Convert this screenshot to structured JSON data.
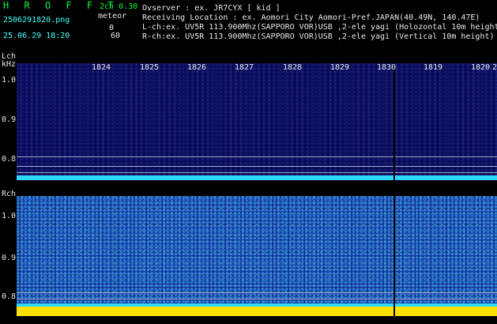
{
  "header": {
    "title": "H R O F F T",
    "channels": "2ch 0.30",
    "filename": "2506291820.png",
    "meteor_label": "meteor",
    "datetime": "25.06.29 18:20",
    "count_top": "0",
    "count_bottom": "60",
    "observer": "Ovserver          : ex. JR7CYX [ kid ]",
    "location": "Receiving Location : ex. Aomori City Aomori-Pref.JAPAN(40.49N, 140.47E)",
    "lch_info": "L-ch:ex. UV5R 113.900Mhz(SAPPORO VOR)USB ,2-ele yagi (Holozontal 10m height)",
    "rch_info": "R-ch:ex. UV5R 113.900Mhz(SAPPORO VOR)USB ,2-ele yagi (Vertical 10m height)"
  },
  "lch": {
    "label": "Lch",
    "unit": "kHz",
    "freq_labels": [
      "1.0",
      "0.9",
      "0.8"
    ]
  },
  "rch": {
    "label": "Rch",
    "freq_labels": [
      "1.0",
      "0.9",
      "0.8"
    ]
  },
  "time_axis": {
    "labels": [
      "1824",
      "1825",
      "1826",
      "1827",
      "1828",
      "1829",
      "1830",
      "1819",
      "1820",
      "2"
    ]
  },
  "colors": {
    "background": "#000000",
    "lch_bg": "#0a0a55",
    "rch_bg": "#12309a",
    "cyan_band": "#30d8ff",
    "yellow_band": "#ffe000",
    "title_green": "#00ff40",
    "text_cyan": "#40ffff"
  }
}
